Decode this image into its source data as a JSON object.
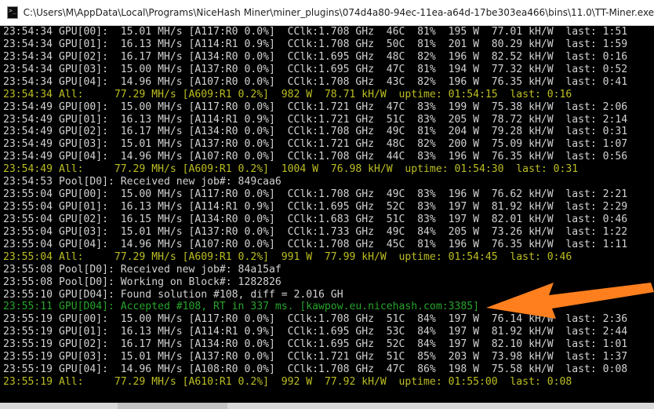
{
  "window": {
    "title": "C:\\Users\\M\\AppData\\Local\\Programs\\NiceHash Miner\\miner_plugins\\074d4a80-94ec-11ea-a64d-17be303ea466\\bins\\11.0\\TT-Miner.exe",
    "icon": "console-icon"
  },
  "console": {
    "lines": [
      {
        "type": "gpu",
        "text": "23:54:34 GPU[00]:  15.01 MH/s [A117:R0 0.0%]  CClk:1.708 GHz  46C  81%  195 W  77.01 kH/W  last: 1:51"
      },
      {
        "type": "gpu",
        "text": "23:54:34 GPU[01]:  16.13 MH/s [A114:R1 0.9%]  CClk:1.708 GHz  50C  81%  201 W  80.29 kH/W  last: 1:59"
      },
      {
        "type": "gpu",
        "text": "23:54:34 GPU[02]:  16.17 MH/s [A134:R0 0.0%]  CClk:1.695 GHz  48C  82%  196 W  82.52 kH/W  last: 0:16"
      },
      {
        "type": "gpu",
        "text": "23:54:34 GPU[03]:  15.00 MH/s [A137:R0 0.0%]  CClk:1.695 GHz  47C  81%  194 W  77.32 kH/W  last: 0:52"
      },
      {
        "type": "gpu",
        "text": "23:54:34 GPU[04]:  14.96 MH/s [A107:R0 0.0%]  CClk:1.708 GHz  43C  82%  196 W  76.35 kH/W  last: 0:41"
      },
      {
        "type": "summary",
        "text": "23:54:34 All:     77.29 MH/s [A609:R1 0.2%]  982 W  78.71 kH/W  uptime: 01:54:15  last: 0:16"
      },
      {
        "type": "gpu",
        "text": "23:54:49 GPU[00]:  15.00 MH/s [A117:R0 0.0%]  CClk:1.721 GHz  47C  83%  199 W  75.38 kH/W  last: 2:06"
      },
      {
        "type": "gpu",
        "text": "23:54:49 GPU[01]:  16.13 MH/s [A114:R1 0.9%]  CClk:1.721 GHz  51C  83%  205 W  78.72 kH/W  last: 2:14"
      },
      {
        "type": "gpu",
        "text": "23:54:49 GPU[02]:  16.17 MH/s [A134:R0 0.0%]  CClk:1.708 GHz  49C  81%  204 W  79.28 kH/W  last: 0:31"
      },
      {
        "type": "gpu",
        "text": "23:54:49 GPU[03]:  15.01 MH/s [A137:R0 0.0%]  CClk:1.721 GHz  48C  82%  200 W  75.09 kH/W  last: 1:07"
      },
      {
        "type": "gpu",
        "text": "23:54:49 GPU[04]:  14.96 MH/s [A107:R0 0.0%]  CClk:1.708 GHz  44C  83%  196 W  76.35 kH/W  last: 0:56"
      },
      {
        "type": "summary",
        "text": "23:54:49 All:     77.29 MH/s [A609:R1 0.2%]  1004 W  76.98 kH/W  uptime: 01:54:30  last: 0:31"
      },
      {
        "type": "info",
        "text": "23:54:53 Pool[D0]: Received new job#: 849caa6"
      },
      {
        "type": "gpu",
        "text": "23:55:04 GPU[00]:  15.00 MH/s [A117:R0 0.0%]  CClk:1.708 GHz  49C  83%  196 W  76.62 kH/W  last: 2:21"
      },
      {
        "type": "gpu",
        "text": "23:55:04 GPU[01]:  16.13 MH/s [A114:R1 0.9%]  CClk:1.695 GHz  52C  83%  197 W  81.92 kH/W  last: 2:29"
      },
      {
        "type": "gpu",
        "text": "23:55:04 GPU[02]:  16.15 MH/s [A134:R0 0.0%]  CClk:1.683 GHz  51C  83%  197 W  82.01 kH/W  last: 0:46"
      },
      {
        "type": "gpu",
        "text": "23:55:04 GPU[03]:  15.01 MH/s [A137:R0 0.0%]  CClk:1.733 GHz  49C  84%  205 W  73.26 kH/W  last: 1:22"
      },
      {
        "type": "gpu",
        "text": "23:55:04 GPU[04]:  14.96 MH/s [A107:R0 0.0%]  CClk:1.708 GHz  45C  81%  196 W  76.35 kH/W  last: 1:11"
      },
      {
        "type": "summary",
        "text": "23:55:04 All:     77.29 MH/s [A609:R1 0.2%]  991 W  77.99 kH/W  uptime: 01:54:45  last: 0:46"
      },
      {
        "type": "info",
        "text": "23:55:08 Pool[D0]: Received new job#: 84a15af"
      },
      {
        "type": "info",
        "text": "23:55:08 Pool[D0]: Working on Block#: 1282826"
      },
      {
        "type": "info",
        "text": "23:55:10 GPU[D04]: Found solution #108, diff = 2.016 GH"
      },
      {
        "type": "accepted",
        "text": "23:55:11 GPU[D04]: Accepted #108, RT in 337 ms. [kawpow.eu.nicehash.com:3385]"
      },
      {
        "type": "gpu",
        "text": "23:55:19 GPU[00]:  15.00 MH/s [A117:R0 0.0%]  CClk:1.708 GHz  51C  84%  197 W  76.14 kH/W  last: 2:36"
      },
      {
        "type": "gpu",
        "text": "23:55:19 GPU[01]:  16.13 MH/s [A114:R1 0.9%]  CClk:1.695 GHz  53C  84%  197 W  81.92 kH/W  last: 2:44"
      },
      {
        "type": "gpu",
        "text": "23:55:19 GPU[02]:  16.17 MH/s [A134:R0 0.0%]  CClk:1.695 GHz  52C  84%  197 W  82.10 kH/W  last: 1:01"
      },
      {
        "type": "gpu",
        "text": "23:55:19 GPU[03]:  15.01 MH/s [A137:R0 0.0%]  CClk:1.721 GHz  51C  85%  203 W  73.98 kH/W  last: 1:37"
      },
      {
        "type": "gpu",
        "text": "23:55:19 GPU[04]:  14.96 MH/s [A108:R0 0.0%]  CClk:1.708 GHz  47C  86%  198 W  75.58 kH/W  last: 0:08"
      },
      {
        "type": "summary",
        "text": "23:55:19 All:     77.29 MH/s [A610:R1 0.2%]  992 W  77.92 kH/W  uptime: 01:55:00  last: 0:08"
      }
    ]
  },
  "colors": {
    "background": "#000000",
    "text": "#d2d2d2",
    "summary": "#bcbe22",
    "accepted": "#27a42b",
    "annotation_arrow": "#ff7f1e"
  },
  "annotation": {
    "arrow_icon": "arrow-icon"
  }
}
